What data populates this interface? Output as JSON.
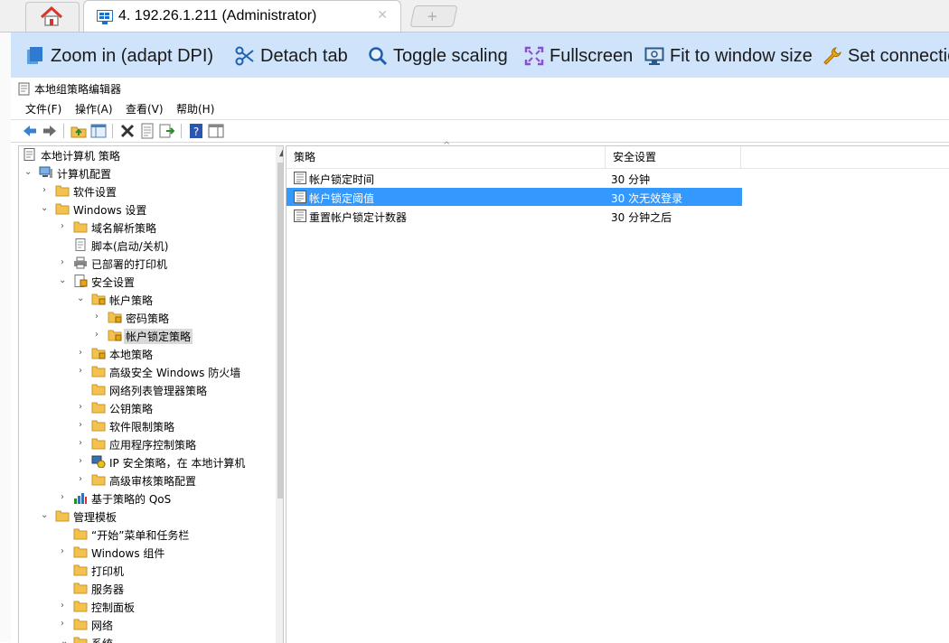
{
  "browser": {
    "active_tab_title": "4. 192.26.1.211 (Administrator)",
    "close_glyph": "✕",
    "new_tab_glyph": "+"
  },
  "remote_toolbar": {
    "zoom_in": "Zoom in (adapt DPI)",
    "detach_tab": "Detach tab",
    "toggle_scaling": "Toggle scaling",
    "fullscreen": "Fullscreen",
    "fit_window": "Fit to window size",
    "set_connection": "Set connectio"
  },
  "app": {
    "title": "本地组策略编辑器",
    "menu": {
      "file": "文件(F)",
      "action": "操作(A)",
      "view": "查看(V)",
      "help": "帮助(H)"
    }
  },
  "tree": {
    "root": "本地计算机 策略",
    "computer_config": "计算机配置",
    "software_settings": "软件设置",
    "windows_settings": "Windows 设置",
    "name_resolution": "域名解析策略",
    "scripts": "脚本(启动/关机)",
    "deployed_printers": "已部署的打印机",
    "security_settings": "安全设置",
    "account_policies": "帐户策略",
    "password_policy": "密码策略",
    "lockout_policy": "帐户锁定策略",
    "local_policies": "本地策略",
    "firewall": "高级安全 Windows 防火墙",
    "network_list": "网络列表管理器策略",
    "public_key": "公钥策略",
    "software_restriction": "软件限制策略",
    "app_control": "应用程序控制策略",
    "ipsec": "IP 安全策略，在 本地计算机",
    "audit": "高级审核策略配置",
    "qos": "基于策略的 QoS",
    "admin_templates": "管理模板",
    "start_menu": "“开始”菜单和任务栏",
    "windows_components": "Windows 组件",
    "printers": "打印机",
    "servers": "服务器",
    "control_panel": "控制面板",
    "network": "网络",
    "system": "系统"
  },
  "list": {
    "columns": {
      "policy": "策略",
      "setting": "安全设置"
    },
    "rows": [
      {
        "policy": "帐户锁定时间",
        "setting": "30 分钟"
      },
      {
        "policy": "帐户锁定阈值",
        "setting": "30 次无效登录"
      },
      {
        "policy": "重置帐户锁定计数器",
        "setting": "30 分钟之后"
      }
    ],
    "selected_row": 1
  },
  "colors": {
    "toolbar_bg": "#cfe3fb",
    "selection": "#3399ff",
    "folder": "#f3c14e"
  }
}
